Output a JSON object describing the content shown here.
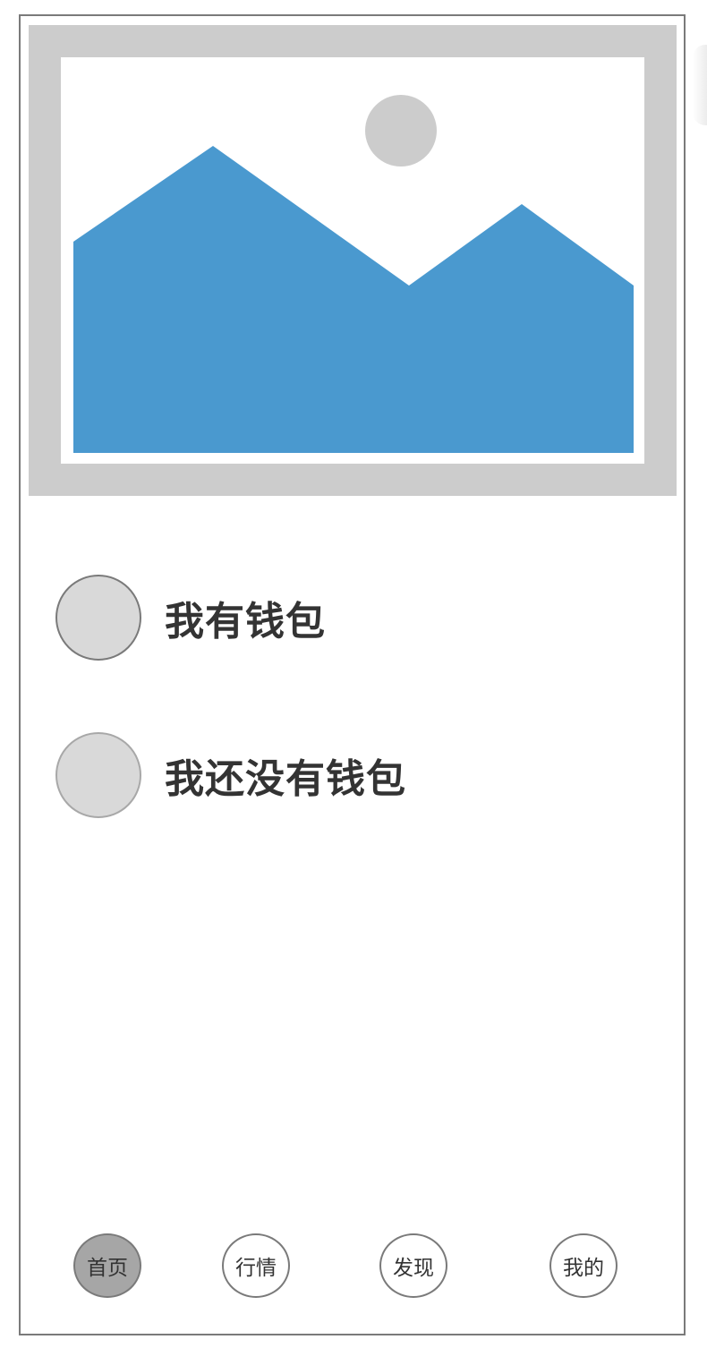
{
  "options": [
    {
      "label": "我有钱包",
      "state": "unselected"
    },
    {
      "label": "我还没有钱包",
      "state": "unselected"
    }
  ],
  "tabbar": {
    "tabs": [
      {
        "label": "首页",
        "active": true
      },
      {
        "label": "行情",
        "active": false
      },
      {
        "label": "发现",
        "active": false
      },
      {
        "label": "我的",
        "active": false
      }
    ]
  },
  "colors": {
    "placeholder_bg": "#cccccc",
    "mountain": "#4a99cf",
    "sun": "#cccccc",
    "radio_fill": "#d9d9d9",
    "active_tab": "#a6a6a6",
    "text": "#333333"
  },
  "banner": {
    "icon": "image-placeholder-icon"
  }
}
